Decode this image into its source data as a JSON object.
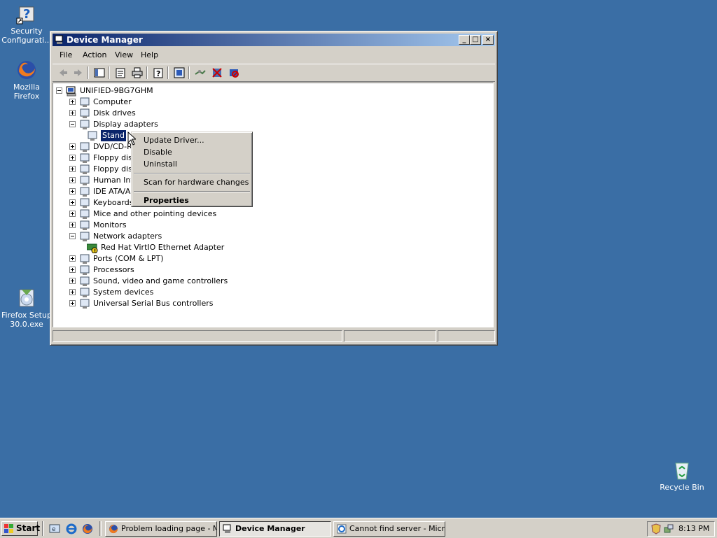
{
  "desktop": {
    "icons": [
      {
        "label": "Security Configurati...",
        "icon": "security-config-icon"
      },
      {
        "label": "Mozilla Firefox",
        "icon": "firefox-icon"
      },
      {
        "label": "Firefox Setup 30.0.exe",
        "icon": "installer-icon"
      },
      {
        "label": "Recycle Bin",
        "icon": "recycle-bin-icon"
      }
    ]
  },
  "window": {
    "title": "Device Manager",
    "menu": [
      "File",
      "Action",
      "View",
      "Help"
    ],
    "toolbar_icons": [
      "back-icon",
      "forward-icon",
      "show-hide-console-tree-icon",
      "properties-icon",
      "print-icon",
      "help-icon",
      "update-driver-icon",
      "scan-hardware-icon",
      "uninstall-icon",
      "disable-icon"
    ]
  },
  "tree": {
    "root": "UNIFIED-9BG7GHM",
    "nodes": [
      {
        "label": "Computer",
        "icon": "computer-icon",
        "expanded": false
      },
      {
        "label": "Disk drives",
        "icon": "disk-drive-icon",
        "expanded": false
      },
      {
        "label": "Display adapters",
        "icon": "display-adapter-icon",
        "expanded": true
      },
      {
        "label": "Stand",
        "icon": "monitor-icon",
        "child": true,
        "selected": true
      },
      {
        "label": "DVD/CD-R",
        "icon": "dvd-icon",
        "expanded": false
      },
      {
        "label": "Floppy disk",
        "icon": "floppy-icon",
        "expanded": false
      },
      {
        "label": "Floppy disk",
        "icon": "floppy-controller-icon",
        "expanded": false
      },
      {
        "label": "Human Int",
        "icon": "hid-icon",
        "expanded": false
      },
      {
        "label": "IDE ATA/A",
        "icon": "ide-icon",
        "expanded": false
      },
      {
        "label": "Keyboards",
        "icon": "keyboard-icon",
        "expanded": false
      },
      {
        "label": "Mice and other pointing devices",
        "icon": "mouse-icon",
        "expanded": false
      },
      {
        "label": "Monitors",
        "icon": "monitor-icon",
        "expanded": false
      },
      {
        "label": "Network adapters",
        "icon": "network-adapter-icon",
        "expanded": true
      },
      {
        "label": "Red Hat VirtIO Ethernet Adapter",
        "icon": "network-adapter-warning-icon",
        "child": true
      },
      {
        "label": "Ports (COM & LPT)",
        "icon": "port-icon",
        "expanded": false
      },
      {
        "label": "Processors",
        "icon": "processor-icon",
        "expanded": false
      },
      {
        "label": "Sound, video and game controllers",
        "icon": "sound-icon",
        "expanded": false
      },
      {
        "label": "System devices",
        "icon": "system-device-icon",
        "expanded": false
      },
      {
        "label": "Universal Serial Bus controllers",
        "icon": "usb-icon",
        "expanded": false
      }
    ]
  },
  "context_menu": {
    "update_driver": "Update Driver...",
    "disable": "Disable",
    "uninstall": "Uninstall",
    "scan": "Scan for hardware changes",
    "properties": "Properties"
  },
  "taskbar": {
    "start": "Start",
    "tasks": [
      "Problem loading page - M...",
      "Device Manager",
      "Cannot find server - Micr..."
    ],
    "clock": "8:13 PM"
  },
  "colors": {
    "desktop": "#3a6ea5",
    "title_active": "#0a246a",
    "selection": "#0a246a",
    "chrome": "#d4d0c8"
  }
}
